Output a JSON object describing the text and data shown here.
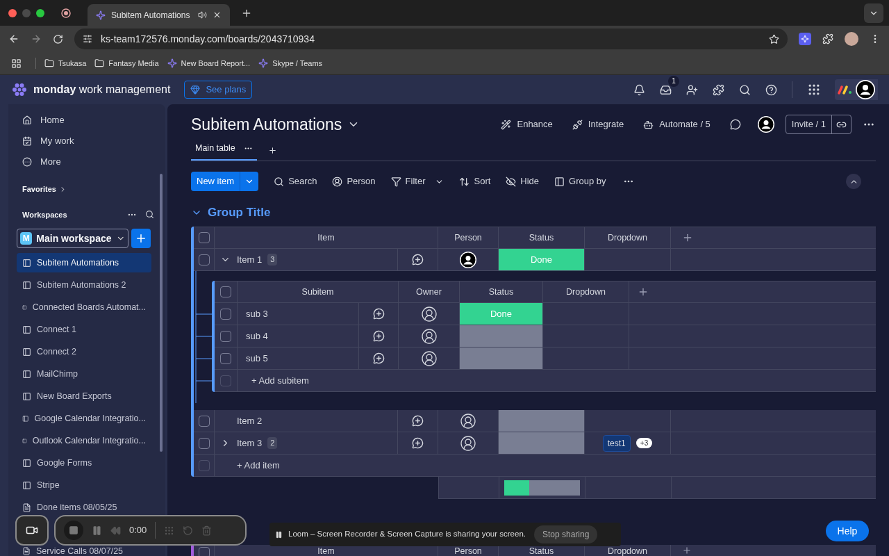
{
  "browser": {
    "tabs": [
      {
        "title": "Subitem Automations",
        "selected": true
      }
    ],
    "url": "ks-team172576.monday.com/boards/2043710934",
    "bookmarks": [
      {
        "label": "Tsukasa",
        "kind": "folder"
      },
      {
        "label": "Fantasy Media",
        "kind": "folder"
      },
      {
        "label": "New Board Report...",
        "kind": "site"
      },
      {
        "label": "Skype / Teams",
        "kind": "site"
      }
    ]
  },
  "topbar": {
    "brand_bold": "monday",
    "brand_rest": "work management",
    "see_plans": "See plans",
    "inbox_count": "1"
  },
  "sidebar": {
    "nav": [
      {
        "label": "Home",
        "kind": "home"
      },
      {
        "label": "My work",
        "kind": "mywork"
      },
      {
        "label": "More",
        "kind": "more"
      }
    ],
    "favorites": "Favorites",
    "workspaces": "Workspaces",
    "workspace_initial": "M",
    "workspace": "Main workspace",
    "boards": [
      {
        "label": "Subitem Automations",
        "kind": "board",
        "selected": true
      },
      {
        "label": "Subitem Automations 2",
        "kind": "board",
        "selected": false
      },
      {
        "label": "Connected Boards Automat...",
        "kind": "board",
        "selected": false
      },
      {
        "label": "Connect 1",
        "kind": "board",
        "selected": false
      },
      {
        "label": "Connect 2",
        "kind": "board",
        "selected": false
      },
      {
        "label": "MailChimp",
        "kind": "board",
        "selected": false
      },
      {
        "label": "New Board Exports",
        "kind": "board",
        "selected": false
      },
      {
        "label": "Google Calendar Integratio...",
        "kind": "board",
        "selected": false
      },
      {
        "label": "Outlook Calendar Integratio...",
        "kind": "board",
        "selected": false
      },
      {
        "label": "Google Forms",
        "kind": "board",
        "selected": false
      },
      {
        "label": "Stripe",
        "kind": "board",
        "selected": false
      },
      {
        "label": "Done items 08/05/25",
        "kind": "doc",
        "selected": false
      }
    ],
    "last_board": {
      "label": "Service Calls 08/07/25",
      "kind": "doc"
    }
  },
  "board": {
    "title": "Subitem Automations",
    "views": [
      {
        "label": "Main table",
        "selected": true
      }
    ],
    "actions": [
      {
        "label": "Enhance",
        "kind": "enhance"
      },
      {
        "label": "Integrate",
        "kind": "integrate"
      },
      {
        "label": "Automate / 5",
        "kind": "automate"
      }
    ],
    "invite": "Invite / 1",
    "new_item": "New item",
    "tools": [
      {
        "label": "Search",
        "kind": "search"
      },
      {
        "label": "Person",
        "kind": "person"
      },
      {
        "label": "Filter",
        "kind": "filter"
      },
      {
        "label": "Sort",
        "kind": "sort"
      },
      {
        "label": "Hide",
        "kind": "hide"
      },
      {
        "label": "Group by",
        "kind": "groupby"
      }
    ]
  },
  "group": {
    "title": "Group Title",
    "all_checked": false,
    "columns": [
      "Item",
      "Person",
      "Status",
      "Dropdown"
    ],
    "items": [
      {
        "name": "Item 1",
        "count": "3",
        "checked": false,
        "expanded": true,
        "has_photo": true,
        "status": {
          "label": "Done",
          "color": "#33d391"
        },
        "subitems": {
          "all_checked": false,
          "columns": [
            "Subitem",
            "Owner",
            "Status",
            "Dropdown"
          ],
          "rows": [
            {
              "name": "sub 3",
              "checked": false,
              "status": {
                "label": "Done",
                "color": "#33d391"
              }
            },
            {
              "name": "sub 4",
              "checked": false,
              "status": {
                "color": "#797e93"
              }
            },
            {
              "name": "sub 5",
              "checked": false,
              "status": {
                "color": "#797e93"
              }
            }
          ],
          "add": "+ Add subitem",
          "add_checked": false
        }
      },
      {
        "name": "Item 2",
        "checked": false,
        "has_photo": false,
        "status": {
          "color": "#797e93"
        }
      },
      {
        "name": "Item 3",
        "count": "2",
        "checked": false,
        "expanded": false,
        "has_photo": false,
        "status": {
          "color": "#797e93"
        },
        "tags": [
          {
            "label": "test1"
          }
        ],
        "more": "+3"
      }
    ],
    "add_item": "+ Add item",
    "add_checked": false,
    "summary": {
      "level": 0.33
    }
  },
  "group2": {
    "all_checked": false,
    "columns": [
      "Item",
      "Person",
      "Status",
      "Dropdown"
    ]
  },
  "loom": {
    "time": "0:00",
    "banner": "Loom – Screen Recorder & Screen Capture is sharing your screen.",
    "stop": "Stop sharing"
  },
  "help": "Help"
}
